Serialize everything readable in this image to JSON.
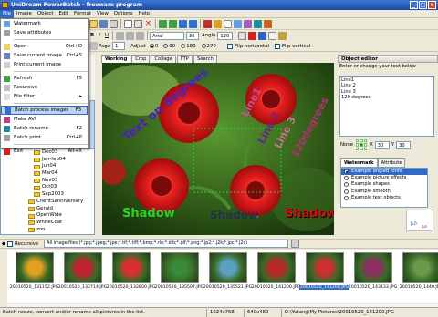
{
  "window": {
    "title": "UniDream PowerBatch - freeware program"
  },
  "menu": [
    "File",
    "Image",
    "Object",
    "Edit",
    "Format",
    "View",
    "Options",
    "Help"
  ],
  "file_menu": [
    {
      "label": "Watermark",
      "shortcut": ""
    },
    {
      "label": "Save attributes",
      "shortcut": ""
    },
    {
      "sep": true
    },
    {
      "label": "Open",
      "shortcut": "Ctrl+O"
    },
    {
      "label": "Save current image",
      "shortcut": "Ctrl+S"
    },
    {
      "label": "Print current image",
      "shortcut": ""
    },
    {
      "sep": true
    },
    {
      "label": "Refresh",
      "shortcut": "F5"
    },
    {
      "label": "Recursive",
      "shortcut": ""
    },
    {
      "label": "File filter",
      "shortcut": "▸"
    },
    {
      "sep": true
    },
    {
      "label": "Batch process images",
      "shortcut": "F3",
      "highlight": true
    },
    {
      "label": "Make AVI",
      "shortcut": ""
    },
    {
      "label": "Batch rename",
      "shortcut": "F2"
    },
    {
      "label": "Batch print",
      "shortcut": "Ctrl+P"
    },
    {
      "sep": true
    },
    {
      "label": "Exit",
      "shortcut": "Alt+X"
    }
  ],
  "toolbar": {
    "font_name": "Arial",
    "font_size": "36",
    "angle_label": "Angle",
    "angle_value": "120",
    "page_label": "Page",
    "page_value": "1",
    "adjust_label": "Adjust",
    "rotations": [
      "0",
      "90",
      "180",
      "270"
    ],
    "rotation_selected": 0,
    "flip_h": "Flip horizontal",
    "flip_v": "Flip vertical"
  },
  "tree": {
    "items": [
      "Dec03",
      "Jan-feb04",
      "Jun04",
      "Mar04",
      "Nov03",
      "Oct03",
      "Sep2003",
      "ChentSanniversary",
      "Gerald",
      "OpenWide",
      "WhiteCoat",
      "zoo"
    ]
  },
  "tabs": [
    "Working",
    "Crop",
    "Collage",
    "FTP",
    "Search"
  ],
  "image_text": {
    "shadow_green": "Shadow",
    "shadow_red": "Shadow",
    "diagonal": "Text on degrees",
    "line1": "Line1",
    "line2": "Line 2",
    "line3": "Line 3",
    "degrees": "120degrees",
    "shadow_mid": "Shadow"
  },
  "object_editor": {
    "title": "Object editor",
    "note": "Enter or change your text below",
    "lines": [
      "Line1",
      "Line 2",
      "Line 3",
      "120 degrees"
    ],
    "pos_label": "None",
    "x_label": "X",
    "x_value": "30",
    "y_label": "Y",
    "y_value": "30"
  },
  "watermark": {
    "tabs": [
      "Watermark",
      "Attribute"
    ],
    "items": [
      "Example angled fonts",
      "Example picture effects",
      "Example shapes",
      "Example smooth",
      "Example text objects"
    ],
    "selected": 0
  },
  "filter": {
    "recursive_label": "Recursive",
    "pattern": "All image files (*.jpg;*.jpeg;*.jpe;*.tif;*.tiff;*.bmp;*.rle;*.dib;*.gif;*.png;*.jp2;*.j2k;*.jpc;*.j2c)"
  },
  "thumbnails": [
    {
      "name": "20010520_131152.JPG",
      "color": "#e0a020"
    },
    {
      "name": "20010520_132714.JPG",
      "color": "#c02030"
    },
    {
      "name": "20010520_132800.JPG",
      "color": "#d83030"
    },
    {
      "name": "20010520_135507.JPG",
      "color": "#3a8a3a"
    },
    {
      "name": "20010520_135521.JPG",
      "color": "#5aa0c0"
    },
    {
      "name": "20010520_141200.JPG",
      "color": "#b82828"
    },
    {
      "name": "20010520_141200.JPG",
      "color": "#cc3030",
      "selected": true
    },
    {
      "name": "20010520_143433.JPG",
      "color": "#8a3060"
    },
    {
      "name": "20010520_1440.JPG",
      "color": "#6a9a4a"
    }
  ],
  "status": {
    "message": "Batch resize, convert and/or rename all pictures in the list.",
    "dims": "1024x768",
    "view": "640x480",
    "path": "D:\\Yutang\\My Pictures\\20010520_141200.JPG"
  },
  "colors": {
    "titlebar": "#1c4aa8",
    "highlight": "#316ac5",
    "flower_red": "#e02020",
    "leaf_green": "#2f5c18"
  }
}
